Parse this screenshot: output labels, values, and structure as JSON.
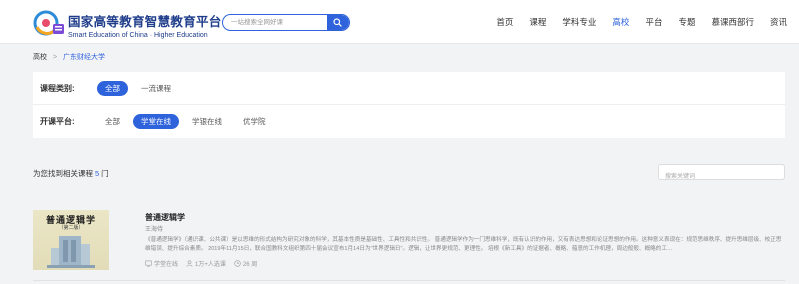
{
  "header": {
    "logo_cn": "国家高等教育智慧教育平台",
    "logo_en": "Smart Education of China · Higher Education",
    "search_placeholder": "一站搜索全网好课",
    "nav": [
      {
        "label": "首页",
        "active": false
      },
      {
        "label": "课程",
        "active": false
      },
      {
        "label": "学科专业",
        "active": false
      },
      {
        "label": "高校",
        "active": true
      },
      {
        "label": "平台",
        "active": false
      },
      {
        "label": "专题",
        "active": false
      },
      {
        "label": "慕课西部行",
        "active": false
      },
      {
        "label": "资讯",
        "active": false
      }
    ]
  },
  "breadcrumb": {
    "home": "高校",
    "separator": ">",
    "current": "广东财经大学"
  },
  "filters": {
    "category": {
      "label": "课程类别:",
      "options": [
        {
          "label": "全部",
          "active": true
        },
        {
          "label": "一流课程",
          "active": false
        }
      ]
    },
    "platform": {
      "label": "开课平台:",
      "options": [
        {
          "label": "全部",
          "active": false
        },
        {
          "label": "学堂在线",
          "active": true
        },
        {
          "label": "学银在线",
          "active": false
        },
        {
          "label": "优学院",
          "active": false
        }
      ]
    }
  },
  "results": {
    "prefix": "为您找到相关课程",
    "count": "5",
    "suffix": "门",
    "keyword_placeholder": "搜索关键词"
  },
  "course": {
    "cover_title": "普通逻辑学",
    "cover_sub": "（第二版）",
    "name": "普通逻辑学",
    "teacher": "王海侍",
    "description": "《普通逻辑学》（通识课、公共课）是以思维的形式结构为研究对象的科学，其基本性质是基础性、工具性和共识性。 普通逻辑学作为一门思维科学，既有认识的作用，又有表达思想和论证思想的作用。这种意义表现在：规范思维秩序、提升思维层级、校正思维错误、提升综合素质。 2019年11月15日，联合国教科文组织第四十届会议宣布1月14日为\"世界逻辑日\"。逻辑，让世界更规范、更理性。 培根《新工具》的证据者、概略、蕴意的工作机理，周边般般、概略的工…",
    "platform": "学堂在线",
    "learners": "1万+人选课",
    "duration": "26 周"
  },
  "colors": {
    "accent": "#2e63dc",
    "page_bg": "#f2f3f5"
  }
}
